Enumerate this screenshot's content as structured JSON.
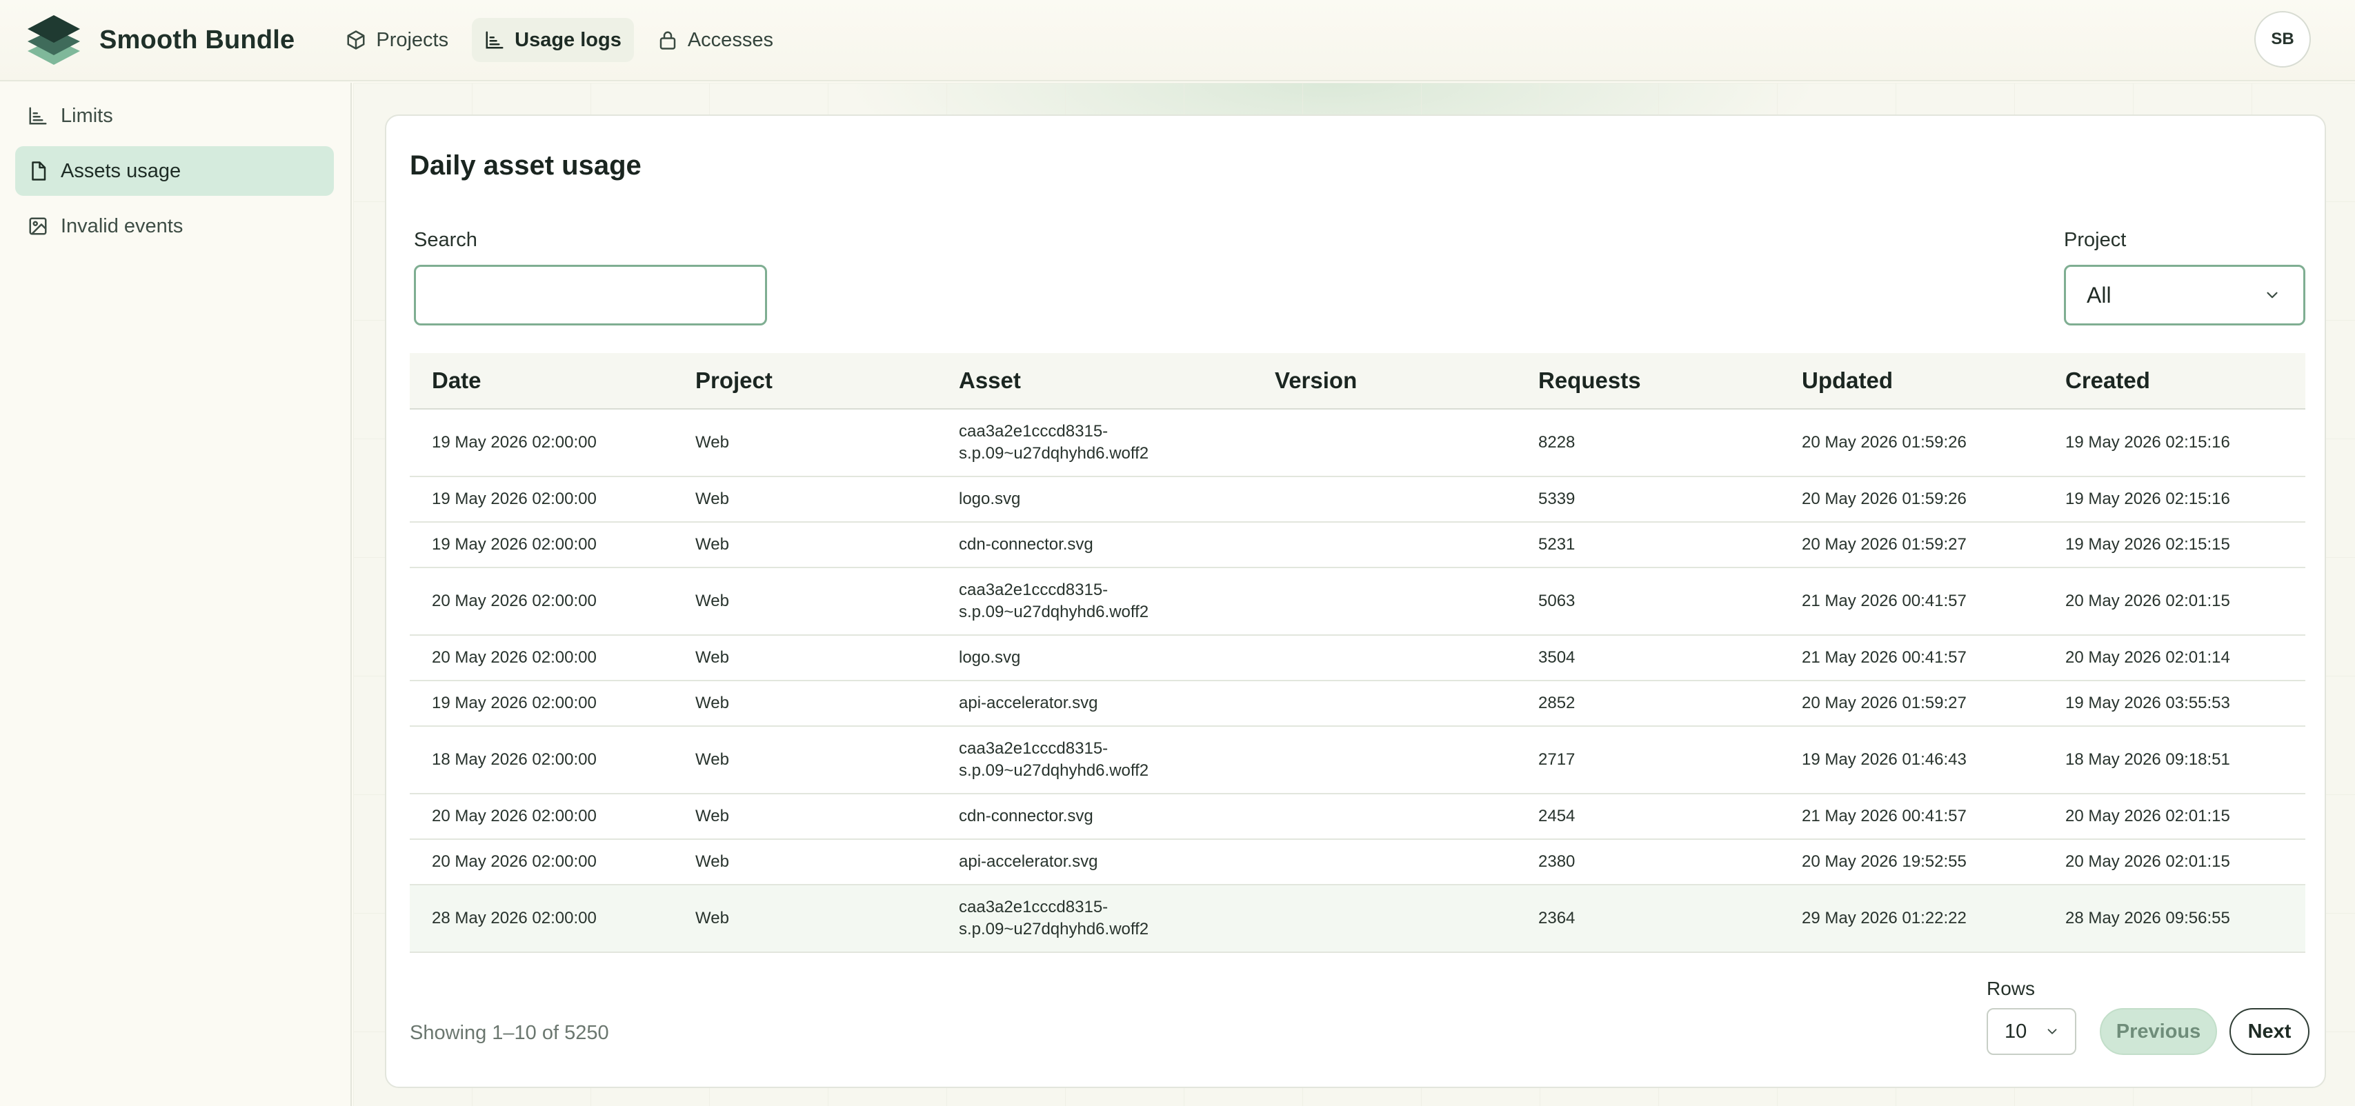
{
  "app": {
    "brand_name": "Smooth Bundle",
    "avatar_initials": "SB",
    "accent_color": "#d5ebdd",
    "nav": [
      {
        "label": "Projects",
        "icon": "cube-icon",
        "active": false
      },
      {
        "label": "Usage logs",
        "icon": "chart-icon",
        "active": true
      },
      {
        "label": "Accesses",
        "icon": "lock-icon",
        "active": false
      }
    ]
  },
  "sidebar": {
    "items": [
      {
        "label": "Limits",
        "icon": "chart-icon",
        "active": false
      },
      {
        "label": "Assets usage",
        "icon": "file-icon",
        "active": true
      },
      {
        "label": "Invalid events",
        "icon": "image-icon",
        "active": false
      }
    ]
  },
  "card": {
    "title": "Daily asset usage",
    "search": {
      "label": "Search",
      "value": "",
      "placeholder": ""
    },
    "project_filter": {
      "label": "Project",
      "selected": "All"
    }
  },
  "table": {
    "columns": [
      "Date",
      "Project",
      "Asset",
      "Version",
      "Requests",
      "Updated",
      "Created"
    ],
    "rows": [
      {
        "date": "19 May 2026 02:00:00",
        "project": "Web",
        "asset_l1": "caa3a2e1cccd8315-",
        "asset_l2": "s.p.09~u27dqhyhd6.woff2",
        "version": "",
        "requests": "8228",
        "updated": "20 May 2026 01:59:26",
        "created": "19 May 2026 02:15:16"
      },
      {
        "date": "19 May 2026 02:00:00",
        "project": "Web",
        "asset_l1": "logo.svg",
        "asset_l2": "",
        "version": "",
        "requests": "5339",
        "updated": "20 May 2026 01:59:26",
        "created": "19 May 2026 02:15:16"
      },
      {
        "date": "19 May 2026 02:00:00",
        "project": "Web",
        "asset_l1": "cdn-connector.svg",
        "asset_l2": "",
        "version": "",
        "requests": "5231",
        "updated": "20 May 2026 01:59:27",
        "created": "19 May 2026 02:15:15"
      },
      {
        "date": "20 May 2026 02:00:00",
        "project": "Web",
        "asset_l1": "caa3a2e1cccd8315-",
        "asset_l2": "s.p.09~u27dqhyhd6.woff2",
        "version": "",
        "requests": "5063",
        "updated": "21 May 2026 00:41:57",
        "created": "20 May 2026 02:01:15"
      },
      {
        "date": "20 May 2026 02:00:00",
        "project": "Web",
        "asset_l1": "logo.svg",
        "asset_l2": "",
        "version": "",
        "requests": "3504",
        "updated": "21 May 2026 00:41:57",
        "created": "20 May 2026 02:01:14"
      },
      {
        "date": "19 May 2026 02:00:00",
        "project": "Web",
        "asset_l1": "api-accelerator.svg",
        "asset_l2": "",
        "version": "",
        "requests": "2852",
        "updated": "20 May 2026 01:59:27",
        "created": "19 May 2026 03:55:53"
      },
      {
        "date": "18 May 2026 02:00:00",
        "project": "Web",
        "asset_l1": "caa3a2e1cccd8315-",
        "asset_l2": "s.p.09~u27dqhyhd6.woff2",
        "version": "",
        "requests": "2717",
        "updated": "19 May 2026 01:46:43",
        "created": "18 May 2026 09:18:51"
      },
      {
        "date": "20 May 2026 02:00:00",
        "project": "Web",
        "asset_l1": "cdn-connector.svg",
        "asset_l2": "",
        "version": "",
        "requests": "2454",
        "updated": "21 May 2026 00:41:57",
        "created": "20 May 2026 02:01:15"
      },
      {
        "date": "20 May 2026 02:00:00",
        "project": "Web",
        "asset_l1": "api-accelerator.svg",
        "asset_l2": "",
        "version": "",
        "requests": "2380",
        "updated": "20 May 2026 19:52:55",
        "created": "20 May 2026 02:01:15"
      },
      {
        "date": "28 May 2026 02:00:00",
        "project": "Web",
        "asset_l1": "caa3a2e1cccd8315-",
        "asset_l2": "s.p.09~u27dqhyhd6.woff2",
        "version": "",
        "requests": "2364",
        "updated": "29 May 2026 01:22:22",
        "created": "28 May 2026 09:56:55"
      }
    ]
  },
  "pagination": {
    "showing": "Showing 1–10 of 5250",
    "rows_label": "Rows",
    "rows_value": "10",
    "previous_label": "Previous",
    "next_label": "Next"
  }
}
